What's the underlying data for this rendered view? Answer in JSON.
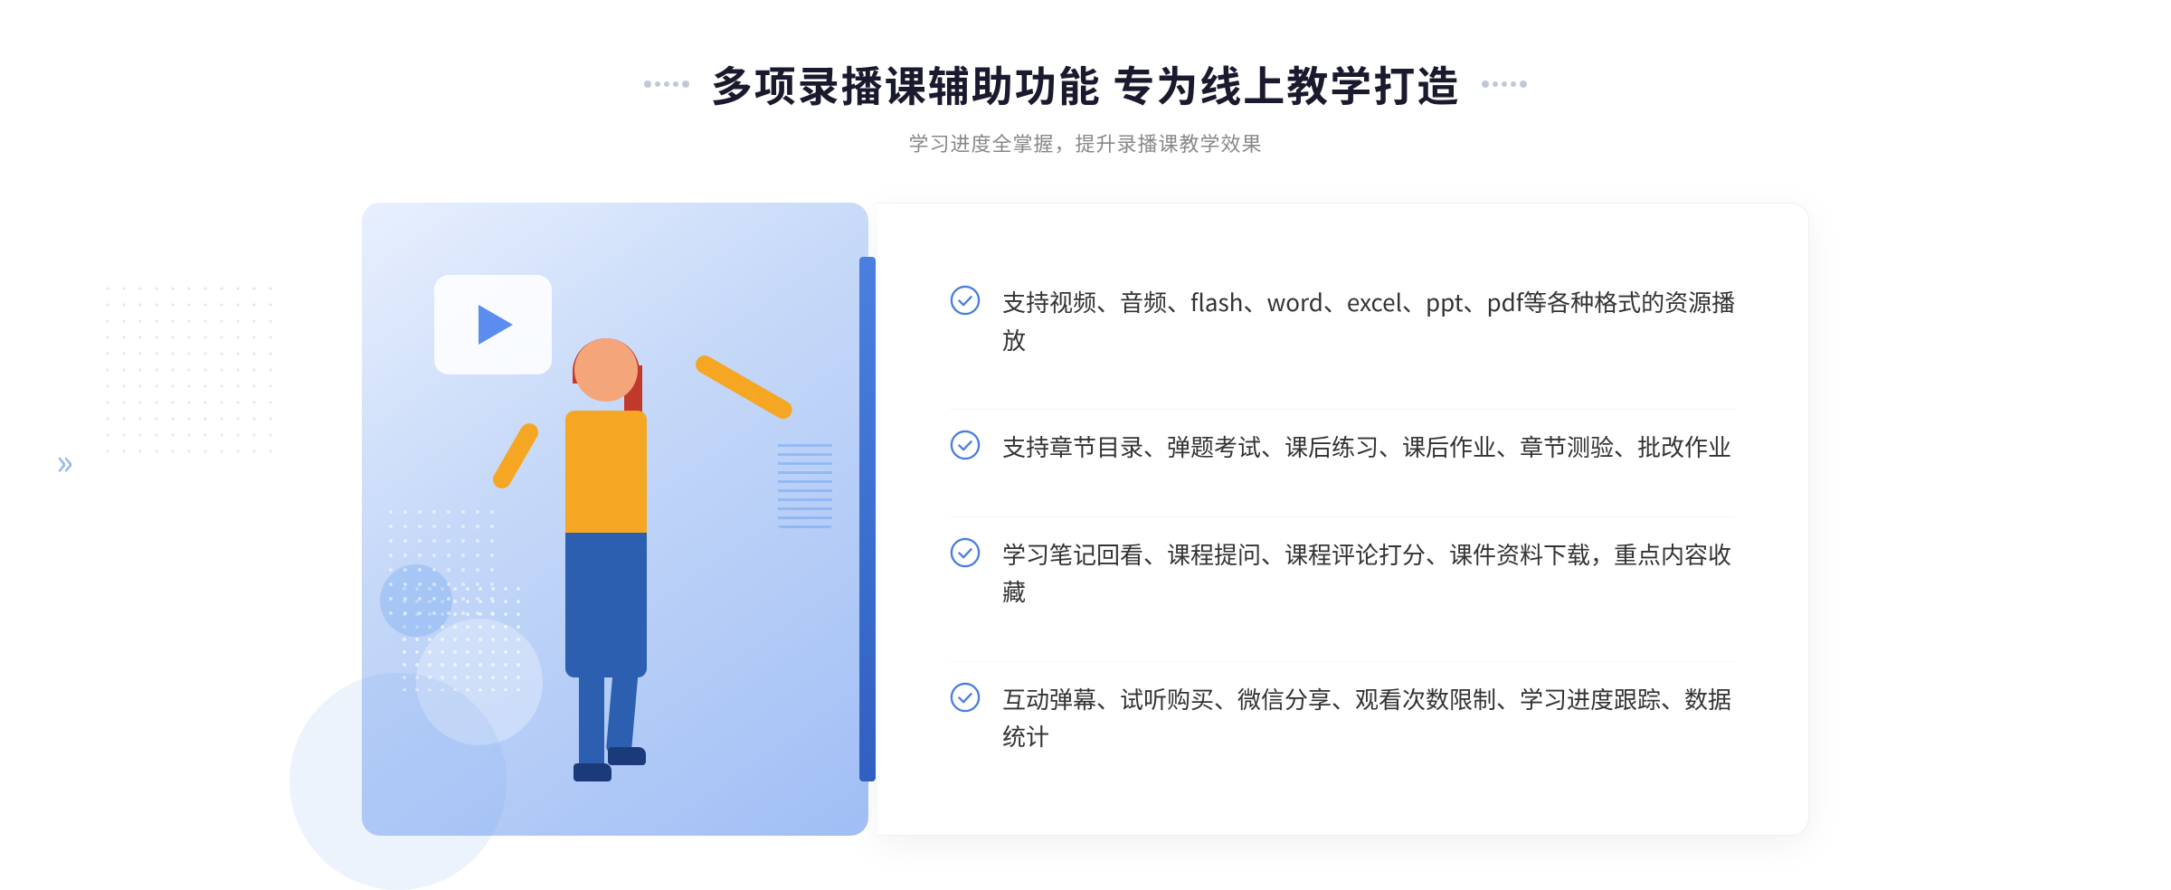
{
  "header": {
    "title": "多项录播课辅助功能 专为线上教学打造",
    "subtitle": "学习进度全掌握，提升录播课教学效果"
  },
  "features": [
    {
      "id": 1,
      "text": "支持视频、音频、flash、word、excel、ppt、pdf等各种格式的资源播放"
    },
    {
      "id": 2,
      "text": "支持章节目录、弹题考试、课后练习、课后作业、章节测验、批改作业"
    },
    {
      "id": 3,
      "text": "学习笔记回看、课程提问、课程评论打分、课件资料下载，重点内容收藏"
    },
    {
      "id": 4,
      "text": "互动弹幕、试听购买、微信分享、观看次数限制、学习进度跟踪、数据统计"
    }
  ],
  "colors": {
    "accent": "#4a7fe0",
    "title": "#1a1a2e",
    "subtitle": "#888888",
    "feature_text": "#333333",
    "check_color": "#4a7fe0"
  }
}
